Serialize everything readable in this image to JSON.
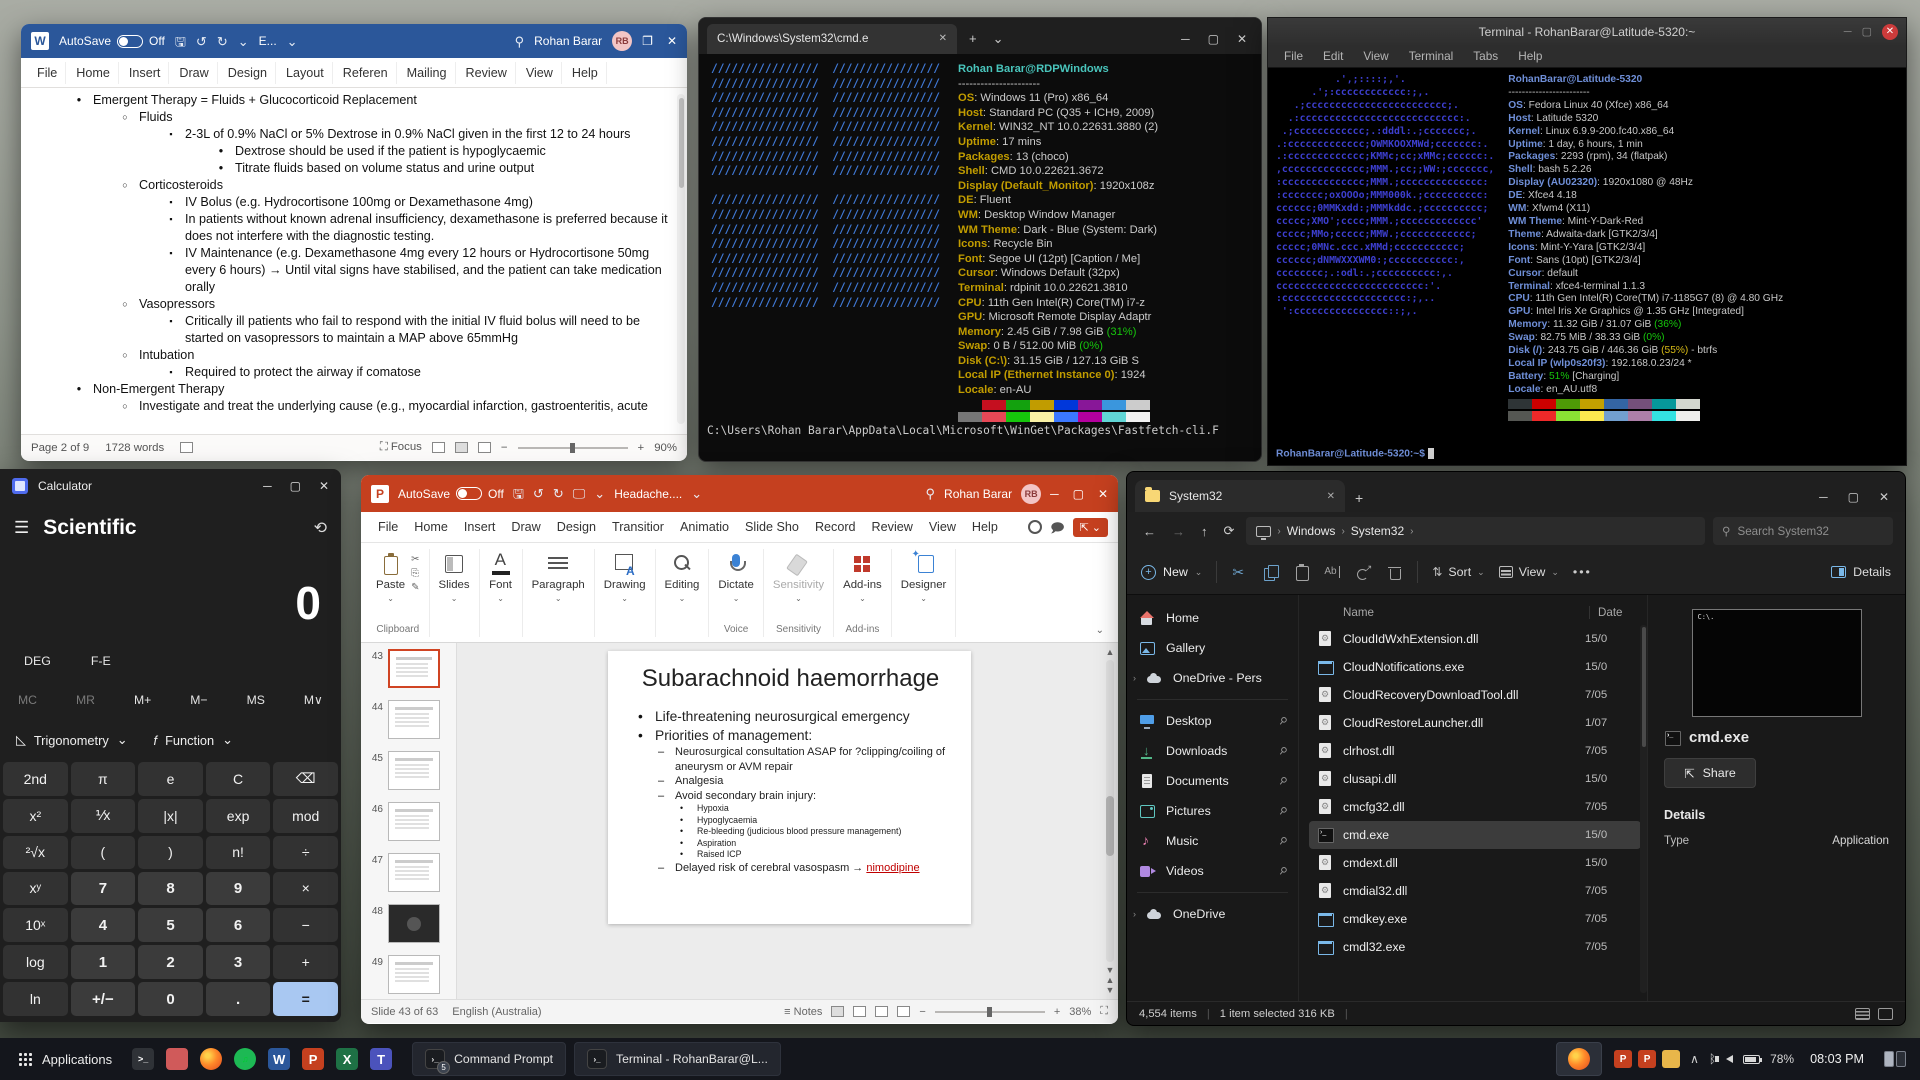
{
  "colors": {
    "word_titlebar": "#2b579a",
    "ppt_titlebar": "#c5401f",
    "cmd_logo_blue": "#4079d6",
    "cmd_key_yellow": "#c19c00",
    "cmd_title_cyan": "#49c5bc",
    "term_key_blue": "#6f8fd8",
    "term_logo_blue": "#3d3fd0",
    "pct_green": "#16c60c",
    "pct_yellow": "#d7ba16",
    "calc_equals": "#a9c8f2"
  },
  "word": {
    "titlebar": {
      "autosave_label": "AutoSave",
      "autosave_state": "Off",
      "doc_name": "E...",
      "user_name": "Rohan Barar",
      "avatar_initials": "RB"
    },
    "menu": [
      "File",
      "Home",
      "Insert",
      "Draw",
      "Design",
      "Layout",
      "Referen",
      "Mailing",
      "Review",
      "View",
      "Help"
    ],
    "doc_lines": [
      {
        "level": 1,
        "text": "Emergent Therapy = Fluids + Glucocorticoid Replacement"
      },
      {
        "level": 2,
        "text": "Fluids"
      },
      {
        "level": 3,
        "text": "2-3L of 0.9% NaCl or 5% Dextrose in 0.9% NaCl given in the first 12 to 24 hours"
      },
      {
        "level": 4,
        "text": "Dextrose should be used if the patient is hypoglycaemic"
      },
      {
        "level": 4,
        "text": "Titrate fluids based on volume status and urine output"
      },
      {
        "level": 2,
        "text": "Corticosteroids"
      },
      {
        "level": 3,
        "text": "IV Bolus (e.g. Hydrocortisone 100mg or Dexamethasone 4mg)"
      },
      {
        "level": 3,
        "text": "In patients without known adrenal insufficiency, dexamethasone is preferred because it does not interfere with the diagnostic testing."
      },
      {
        "level": 3,
        "text": "IV Maintenance (e.g. Dexamethasone 4mg every 12 hours or Hydrocortisone 50mg every 6 hours) → Until vital signs have stabilised, and the patient can take medication orally"
      },
      {
        "level": 2,
        "text": "Vasopressors"
      },
      {
        "level": 3,
        "text": "Critically ill patients who fail to respond with the initial IV fluid bolus will need to be started on vasopressors to maintain a MAP above 65mmHg"
      },
      {
        "level": 2,
        "text": "Intubation"
      },
      {
        "level": 3,
        "text": "Required to protect the airway if comatose"
      },
      {
        "level": 1,
        "text": "Non-Emergent Therapy"
      },
      {
        "level": 2,
        "text": "Investigate and treat the underlying cause (e.g., myocardial infarction, gastroenteritis, acute"
      }
    ],
    "status": {
      "page": "Page 2 of 9",
      "words": "1728 words",
      "focus_label": "Focus",
      "zoom_level": "90%"
    }
  },
  "cmd": {
    "tab_title": "C:\\Windows\\System32\\cmd.e",
    "fastfetch_title": "Rohan Barar@RDPWindows",
    "separator": "----------------------",
    "logo_lines": [
      "////////////////  ////////////////",
      "////////////////  ////////////////",
      "////////////////  ////////////////",
      "////////////////  ////////////////",
      "////////////////  ////////////////",
      "////////////////  ////////////////",
      "////////////////  ////////////////",
      "////////////////  ////////////////",
      "",
      "////////////////  ////////////////",
      "////////////////  ////////////////",
      "////////////////  ////////////////",
      "////////////////  ////////////////",
      "////////////////  ////////////////",
      "////////////////  ////////////////",
      "////////////////  ////////////////",
      "////////////////  ////////////////"
    ],
    "info": [
      {
        "key": "OS",
        "value": "Windows 11 (Pro) x86_64"
      },
      {
        "key": "Host",
        "value": "Standard PC (Q35 + ICH9, 2009)"
      },
      {
        "key": "Kernel",
        "value": "WIN32_NT 10.0.22631.3880 (2)"
      },
      {
        "key": "Uptime",
        "value": "17 mins"
      },
      {
        "key": "Packages",
        "value": "13 (choco)"
      },
      {
        "key": "Shell",
        "value": "CMD 10.0.22621.3672"
      },
      {
        "key": "Display (Default_Monitor)",
        "value": "1920x108z"
      },
      {
        "key": "DE",
        "value": "Fluent"
      },
      {
        "key": "WM",
        "value": "Desktop Window Manager"
      },
      {
        "key": "WM Theme",
        "value": "Dark - Blue (System: Dark)"
      },
      {
        "key": "Icons",
        "value": "Recycle Bin"
      },
      {
        "key": "Font",
        "value": "Segoe UI (12pt) [Caption / Me]"
      },
      {
        "key": "Cursor",
        "value": "Windows Default (32px)"
      },
      {
        "key": "Terminal",
        "value": "rdpinit 10.0.22621.3810"
      },
      {
        "key": "CPU",
        "value": "11th Gen Intel(R) Core(TM) i7-z"
      },
      {
        "key": "GPU",
        "value": "Microsoft Remote Display Adaptr"
      },
      {
        "key": "Memory",
        "value": "2.45 GiB / 7.98 GiB ",
        "pct": "(31%)"
      },
      {
        "key": "Swap",
        "value": "0 B / 512.00 MiB ",
        "pct": "(0%)"
      },
      {
        "key": "Disk (C:\\)",
        "value": "31.15 GiB / 127.13 GiB S"
      },
      {
        "key": "Local IP (Ethernet Instance 0)",
        "value": "1924"
      },
      {
        "key": "Locale",
        "value": "en-AU"
      }
    ],
    "palette": [
      [
        "#0c0c0c",
        "#c50f1f",
        "#13a10e",
        "#c19c00",
        "#0037da",
        "#881798",
        "#3a96dd",
        "#cccccc"
      ],
      [
        "#767676",
        "#e74856",
        "#16c60c",
        "#f9f1a5",
        "#3b78ff",
        "#b4009e",
        "#61d6d6",
        "#f2f2f2"
      ]
    ],
    "path_line": "C:\\Users\\Rohan Barar\\AppData\\Local\\Microsoft\\WinGet\\Packages\\Fastfetch-cli.F"
  },
  "terminal": {
    "window_title": "Terminal - RohanBarar@Latitude-5320:~",
    "menu": [
      "File",
      "Edit",
      "View",
      "Terminal",
      "Tabs",
      "Help"
    ],
    "fastfetch_title": "RohanBarar@Latitude-5320",
    "separator": "------------------------",
    "logo_lines": [
      "          .',;::::;,'.",
      "      .';:cccccccccccc:;,.",
      "   .;cccccccccccccccccccccccc;.",
      "  .:ccccccccccccccccccccccccccc:.",
      " .;cccccccccccc;.:dddl:.;ccccccc;.",
      ".:ccccccccccccc;OWMKOOXMWd;ccccccc:.",
      ".:ccccccccccccc;KMMc;cc;xMMc;cccccc:.",
      ",cccccccccccccc;MMM.;cc;;WW:;ccccccc,",
      ":cccccccccccccc;MMM.;cccccccccccccc:",
      ":ccccccc;oxOOOo;MMM000k.;cccccccccc:",
      "cccccc;0MMKxdd:;MMMkddc.;cccccccccc;",
      "ccccc;XMO';cccc;MMM.;ccccccccccccc'",
      "ccccc;MMo;ccccc;MMW.;cccccccccccc;",
      "ccccc;0MNc.ccc.xMMd;ccccccccccc;",
      "cccccc;dNMWXXXWM0:;ccccccccccc:,",
      "cccccccc;.:odl:.;cccccccccc:,.",
      "ccccccccccccccccccccccccc:'.",
      ":ccccccccccccccccccccc:;,..",
      " ':cccccccccccccccc::;,."
    ],
    "info": [
      {
        "key": "OS",
        "value": "Fedora Linux 40 (Xfce) x86_64"
      },
      {
        "key": "Host",
        "value": "Latitude 5320"
      },
      {
        "key": "Kernel",
        "value": "Linux 6.9.9-200.fc40.x86_64"
      },
      {
        "key": "Uptime",
        "value": "1 day, 6 hours, 1 min"
      },
      {
        "key": "Packages",
        "value": "2293 (rpm), 34 (flatpak)"
      },
      {
        "key": "Shell",
        "value": "bash 5.2.26"
      },
      {
        "key": "Display (AU02320)",
        "value": "1920x1080 @ 48Hz"
      },
      {
        "key": "DE",
        "value": "Xfce4 4.18"
      },
      {
        "key": "WM",
        "value": "Xfwm4 (X11)"
      },
      {
        "key": "WM Theme",
        "value": "Mint-Y-Dark-Red"
      },
      {
        "key": "Theme",
        "value": "Adwaita-dark [GTK2/3/4]"
      },
      {
        "key": "Icons",
        "value": "Mint-Y-Yara [GTK2/3/4]"
      },
      {
        "key": "Font",
        "value": "Sans (10pt) [GTK2/3/4]"
      },
      {
        "key": "Cursor",
        "value": "default"
      },
      {
        "key": "Terminal",
        "value": "xfce4-terminal 1.1.3"
      },
      {
        "key": "CPU",
        "value": "11th Gen Intel(R) Core(TM) i7-1185G7 (8) @ 4.80 GHz"
      },
      {
        "key": "GPU",
        "value": "Intel Iris Xe Graphics @ 1.35 GHz [Integrated]"
      },
      {
        "key": "Memory",
        "value": "11.32 GiB / 31.07 GiB ",
        "pct": "(36%)"
      },
      {
        "key": "Swap",
        "value": "82.75 MiB / 38.33 GiB ",
        "pct": "(0%)"
      },
      {
        "key": "Disk (/)",
        "value": "243.75 GiB / 446.36 GiB ",
        "pct": "(55%)",
        "pctc": "y",
        "suffix": " - btrfs"
      },
      {
        "key": "Local IP (wlp0s20f3)",
        "value": "192.168.0.23/24 *"
      },
      {
        "key": "Battery",
        "value": "",
        "pct": "51%",
        "suffix": " [Charging]"
      },
      {
        "key": "Locale",
        "value": "en_AU.utf8"
      }
    ],
    "palette": [
      [
        "#2e3436",
        "#cc0000",
        "#4e9a06",
        "#c4a000",
        "#3465a4",
        "#75507b",
        "#06989a",
        "#d3d7cf"
      ],
      [
        "#555753",
        "#ef2929",
        "#8ae234",
        "#fce94f",
        "#729fcf",
        "#ad7fa8",
        "#34e2e2",
        "#eeeeec"
      ]
    ],
    "prompt": "RohanBarar@Latitude-5320:~$"
  },
  "calculator": {
    "window_title": "Calculator",
    "mode": "Scientific",
    "display_value": "0",
    "angle_unit": "DEG",
    "fe_label": "F-E",
    "memory_keys": [
      "MC",
      "MR",
      "M+",
      "M−",
      "MS",
      "M∨"
    ],
    "memory_disabled": [
      "MC",
      "MR"
    ],
    "trig_label": "Trigonometry",
    "func_label": "Function",
    "keys": [
      [
        "2nd",
        "π",
        "e",
        "C",
        "⌫"
      ],
      [
        "x²",
        "⅟x",
        "|x|",
        "exp",
        "mod"
      ],
      [
        "²√x",
        "(",
        ")",
        "n!",
        "÷"
      ],
      [
        "xʸ",
        "7",
        "8",
        "9",
        "×"
      ],
      [
        "10ˣ",
        "4",
        "5",
        "6",
        "−"
      ],
      [
        "log",
        "1",
        "2",
        "3",
        "+"
      ],
      [
        "ln",
        "+/−",
        "0",
        ".",
        "="
      ]
    ]
  },
  "powerpoint": {
    "titlebar": {
      "autosave_label": "AutoSave",
      "autosave_state": "Off",
      "doc_name": "Headache....",
      "user_name": "Rohan Barar",
      "avatar_initials": "RB"
    },
    "menu": [
      "File",
      "Home",
      "Insert",
      "Draw",
      "Design",
      "Transitior",
      "Animatio",
      "Slide Sho",
      "Record",
      "Review",
      "View",
      "Help"
    ],
    "ribbon_groups": [
      {
        "button": "Paste",
        "group_label": "Clipboard",
        "icon": "clipboard",
        "minis": true
      },
      {
        "button": "Slides",
        "icon": "slides"
      },
      {
        "button": "Font",
        "icon": "font"
      },
      {
        "button": "Paragraph",
        "icon": "paragraph"
      },
      {
        "button": "Drawing",
        "icon": "drawing"
      },
      {
        "button": "Editing",
        "icon": "editing"
      },
      {
        "button": "Dictate",
        "group_label": "Voice",
        "icon": "mic"
      },
      {
        "button": "Sensitivity",
        "group_label": "Sensitivity",
        "icon": "sensitivity",
        "disabled": true
      },
      {
        "button": "Add-ins",
        "group_label": "Add-ins",
        "icon": "addins"
      },
      {
        "button": "Designer",
        "icon": "designer"
      }
    ],
    "thumbnails": [
      {
        "num": "43",
        "selected": true
      },
      {
        "num": "44"
      },
      {
        "num": "45"
      },
      {
        "num": "46"
      },
      {
        "num": "47"
      },
      {
        "num": "48",
        "dark": true
      },
      {
        "num": "49"
      }
    ],
    "slide": {
      "title": "Subarachnoid haemorrhage",
      "bullets": [
        {
          "level": 1,
          "text": "Life-threatening neurosurgical emergency"
        },
        {
          "level": 1,
          "text": "Priorities of management:"
        },
        {
          "level": 2,
          "text": "Neurosurgical consultation ASAP for ?clipping/coiling of aneurysm or AVM repair"
        },
        {
          "level": 2,
          "text": "Analgesia"
        },
        {
          "level": 2,
          "text": "Avoid secondary brain injury:"
        },
        {
          "level": 3,
          "text": "Hypoxia"
        },
        {
          "level": 3,
          "text": "Hypoglycaemia"
        },
        {
          "level": 3,
          "text": "Re-bleeding (judicious blood pressure management)"
        },
        {
          "level": 3,
          "text": "Aspiration"
        },
        {
          "level": 3,
          "text": "Raised ICP"
        },
        {
          "level": 2,
          "text": "Delayed risk of cerebral vasospasm → ",
          "highlight": "nimodipine"
        }
      ]
    },
    "status": {
      "slide_label": "Slide 43 of 63",
      "language": "English (Australia)",
      "notes_label": "Notes",
      "zoom_level": "38%"
    }
  },
  "explorer": {
    "tab_title": "System32",
    "breadcrumb": [
      "Windows",
      "System32"
    ],
    "search_placeholder": "Search System32",
    "toolbar": {
      "new_label": "New",
      "sort_label": "Sort",
      "view_label": "View",
      "details_label": "Details"
    },
    "sidebar": [
      {
        "label": "Home",
        "icon": "home"
      },
      {
        "label": "Gallery",
        "icon": "gallery"
      },
      {
        "label": "OneDrive - Pers",
        "icon": "cloud",
        "chev": true
      },
      {
        "sep": true
      },
      {
        "label": "Desktop",
        "icon": "desktop",
        "pin": true
      },
      {
        "label": "Downloads",
        "icon": "down",
        "pin": true
      },
      {
        "label": "Documents",
        "icon": "docs",
        "pin": true
      },
      {
        "label": "Pictures",
        "icon": "pics",
        "pin": true
      },
      {
        "label": "Music",
        "icon": "music",
        "pin": true
      },
      {
        "label": "Videos",
        "icon": "video",
        "pin": true
      },
      {
        "sep": true
      },
      {
        "label": "OneDrive",
        "icon": "cloud",
        "chev": true
      }
    ],
    "columns": {
      "name": "Name",
      "date": "Date"
    },
    "files": [
      {
        "name": "CloudIdWxhExtension.dll",
        "date": "15/0",
        "type": "dll"
      },
      {
        "name": "CloudNotifications.exe",
        "date": "15/0",
        "type": "exe"
      },
      {
        "name": "CloudRecoveryDownloadTool.dll",
        "date": "7/05",
        "type": "dll"
      },
      {
        "name": "CloudRestoreLauncher.dll",
        "date": "1/07",
        "type": "dll"
      },
      {
        "name": "clrhost.dll",
        "date": "7/05",
        "type": "dll"
      },
      {
        "name": "clusapi.dll",
        "date": "15/0",
        "type": "dll"
      },
      {
        "name": "cmcfg32.dll",
        "date": "7/05",
        "type": "dll"
      },
      {
        "name": "cmd.exe",
        "date": "15/0",
        "type": "cmd",
        "selected": true
      },
      {
        "name": "cmdext.dll",
        "date": "15/0",
        "type": "dll"
      },
      {
        "name": "cmdial32.dll",
        "date": "7/05",
        "type": "dll"
      },
      {
        "name": "cmdkey.exe",
        "date": "7/05",
        "type": "exe"
      },
      {
        "name": "cmdl32.exe",
        "date": "7/05",
        "type": "exe"
      }
    ],
    "preview": {
      "file_name": "cmd.exe",
      "share_label": "Share",
      "details_label": "Details",
      "type_label": "Type",
      "type_value": "Application"
    },
    "status": {
      "items_count": "4,554 items",
      "selection": "1 item selected 316 KB"
    }
  },
  "taskbar": {
    "menu_label": "Applications",
    "launchers": [
      "terminal",
      "files",
      "firefox",
      "spotify",
      "word",
      "powerpoint",
      "excel",
      "teams"
    ],
    "launcher_letters": {
      "word": "W",
      "powerpoint": "P",
      "excel": "X",
      "teams": "T",
      "terminal": ">_",
      "files": "",
      "firefox": "",
      "spotify": "♫"
    },
    "window_buttons": [
      {
        "label": "Command Prompt",
        "badge": "5",
        "icon": "cmd"
      },
      {
        "label": "Terminal - RohanBarar@L...",
        "icon": "terminal"
      }
    ],
    "tray_apps": [
      "powerpoint",
      "powerpoint",
      "files"
    ],
    "battery_percent": "78%",
    "clock": "08:03 PM"
  }
}
